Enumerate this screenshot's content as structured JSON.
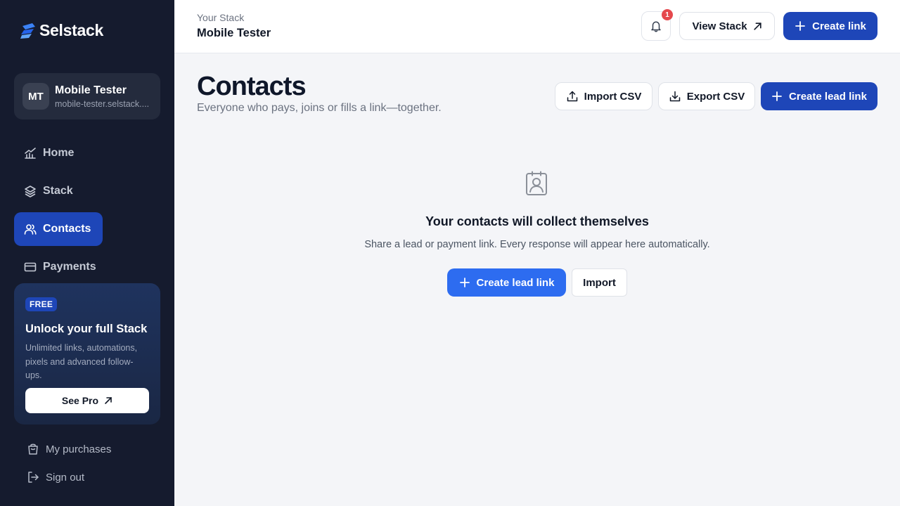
{
  "sidebar": {
    "brand": "Selstack",
    "profile": {
      "initials": "MT",
      "name": "Mobile Tester",
      "url": "mobile-tester.selstack...."
    },
    "nav": [
      {
        "label": "Home",
        "icon": "chart-icon"
      },
      {
        "label": "Stack",
        "icon": "layers-icon"
      },
      {
        "label": "Contacts",
        "icon": "users-icon",
        "active": true
      },
      {
        "label": "Payments",
        "icon": "card-icon"
      }
    ],
    "promo": {
      "badge": "FREE",
      "title": "Unlock your full Stack",
      "description": "Unlimited links, automations, pixels and advanced follow-ups.",
      "cta": "See Pro"
    },
    "bottom": [
      {
        "label": "My purchases",
        "icon": "bag-icon"
      },
      {
        "label": "Sign out",
        "icon": "sign-out-icon"
      }
    ]
  },
  "topbar": {
    "label": "Your Stack",
    "stack_name": "Mobile Tester",
    "notification_count": "1",
    "view_stack": "View Stack",
    "create_link": "Create link"
  },
  "page": {
    "title": "Contacts",
    "subtitle": "Everyone who pays, joins or fills a link—together.",
    "import_csv": "Import CSV",
    "export_csv": "Export CSV",
    "create_lead_link": "Create lead link"
  },
  "empty_state": {
    "icon": "contact-badge-icon",
    "title": "Your contacts will collect themselves",
    "description": "Share a lead or payment link. Every response will appear here automatically.",
    "primary": "Create lead link",
    "secondary": "Import"
  },
  "colors": {
    "sidebar_bg": "#151b2e",
    "accent": "#1e46b8",
    "accent_bright": "#2d6cf0",
    "badge": "#e5484d"
  }
}
